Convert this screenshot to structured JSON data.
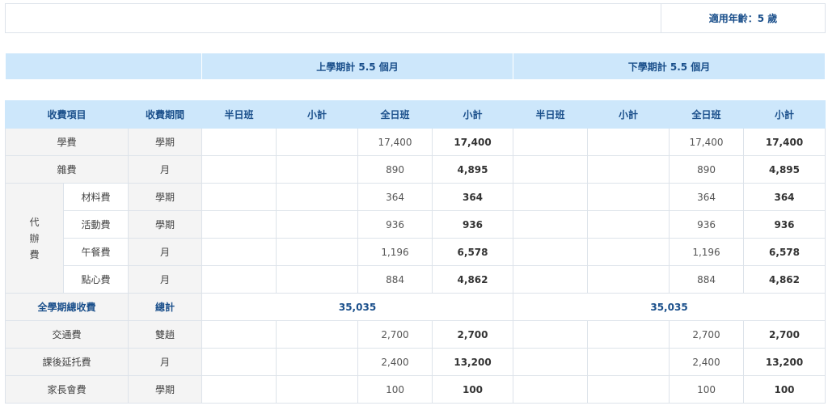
{
  "age_label": "適用年齡：5 歲",
  "semesters": {
    "first": "上學期計  5.5  個月",
    "second": "下學期計  5.5  個月"
  },
  "headers": [
    "收費項目",
    "收費期間",
    "半日班",
    "小計",
    "全日班",
    "小計",
    "半日班",
    "小計",
    "全日班",
    "小計"
  ],
  "group_label": [
    "代",
    "辦",
    "費"
  ],
  "rows": [
    {
      "item": "學費",
      "period": "學期",
      "full1": "17,400",
      "sub1": "17,400",
      "full2": "17,400",
      "sub2": "17,400"
    },
    {
      "item": "雜費",
      "period": "月",
      "full1": "890",
      "sub1": "4,895",
      "full2": "890",
      "sub2": "4,895"
    }
  ],
  "group_rows": [
    {
      "item": "材料費",
      "period": "學期",
      "full1": "364",
      "sub1": "364",
      "full2": "364",
      "sub2": "364"
    },
    {
      "item": "活動費",
      "period": "學期",
      "full1": "936",
      "sub1": "936",
      "full2": "936",
      "sub2": "936"
    },
    {
      "item": "午餐費",
      "period": "月",
      "full1": "1,196",
      "sub1": "6,578",
      "full2": "1,196",
      "sub2": "6,578"
    },
    {
      "item": "點心費",
      "period": "月",
      "full1": "884",
      "sub1": "4,862",
      "full2": "884",
      "sub2": "4,862"
    }
  ],
  "total": {
    "label": "全學期總收費",
    "period": "總計",
    "full1": "35,035",
    "full2": "35,035"
  },
  "extra_rows": [
    {
      "item": "交通費",
      "period": "雙趟",
      "full1": "2,700",
      "sub1": "2,700",
      "full2": "2,700",
      "sub2": "2,700"
    },
    {
      "item": "課後延托費",
      "period": "月",
      "full1": "2,400",
      "sub1": "13,200",
      "full2": "2,400",
      "sub2": "13,200"
    },
    {
      "item": "家長會費",
      "period": "學期",
      "full1": "100",
      "sub1": "100",
      "full2": "100",
      "sub2": "100"
    }
  ]
}
